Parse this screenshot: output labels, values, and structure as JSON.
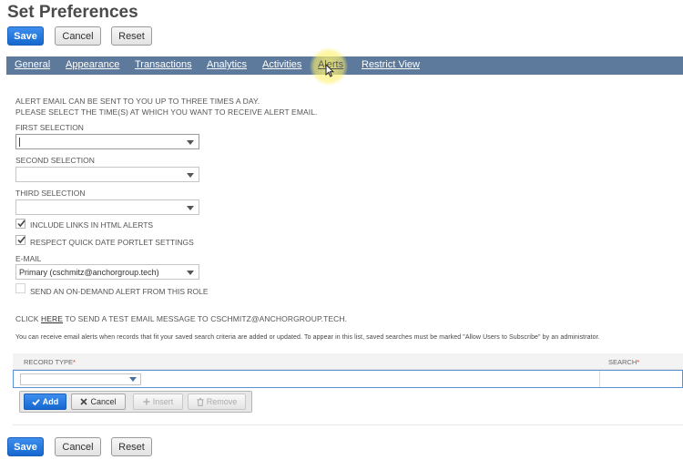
{
  "page": {
    "title": "Set Preferences"
  },
  "toolbar": {
    "save": "Save",
    "cancel": "Cancel",
    "reset": "Reset"
  },
  "tabs": [
    "General",
    "Appearance",
    "Transactions",
    "Analytics",
    "Activities",
    "Alerts",
    "Restrict View"
  ],
  "alerts": {
    "intro_line1": "ALERT EMAIL CAN BE SENT TO YOU UP TO THREE TIMES A DAY.",
    "intro_line2": "PLEASE SELECT THE TIME(S) AT WHICH YOU WANT TO RECEIVE ALERT EMAIL.",
    "first_selection": {
      "label": "FIRST SELECTION",
      "value": ""
    },
    "second_selection": {
      "label": "SECOND SELECTION",
      "value": ""
    },
    "third_selection": {
      "label": "THIRD SELECTION",
      "value": ""
    },
    "include_links": {
      "label": "INCLUDE LINKS IN HTML ALERTS",
      "checked": true
    },
    "respect_quick_date": {
      "label": "RESPECT QUICK DATE PORTLET SETTINGS",
      "checked": true
    },
    "email": {
      "label": "E-MAIL",
      "value": "Primary (cschmitz@anchorgroup.tech)"
    },
    "on_demand": {
      "label": "SEND AN ON-DEMAND ALERT FROM THIS ROLE",
      "checked": false
    },
    "test_email": {
      "prefix": "CLICK ",
      "link": "HERE",
      "suffix": " TO SEND A TEST EMAIL MESSAGE TO CSCHMITZ@ANCHORGROUP.TECH."
    },
    "saved_search_note": "You can receive email alerts when records that fit your saved search criteria are added or updated. To appear in this list, saved searches must be marked \"Allow Users to Subscribe\" by an administrator."
  },
  "sublist": {
    "columns": {
      "record_type": "RECORD TYPE",
      "search": "SEARCH",
      "required_mark": "*"
    },
    "buttons": {
      "add": "Add",
      "cancel": "Cancel",
      "insert": "Insert",
      "remove": "Remove"
    }
  },
  "footer": {
    "save": "Save",
    "cancel": "Cancel",
    "reset": "Reset"
  }
}
